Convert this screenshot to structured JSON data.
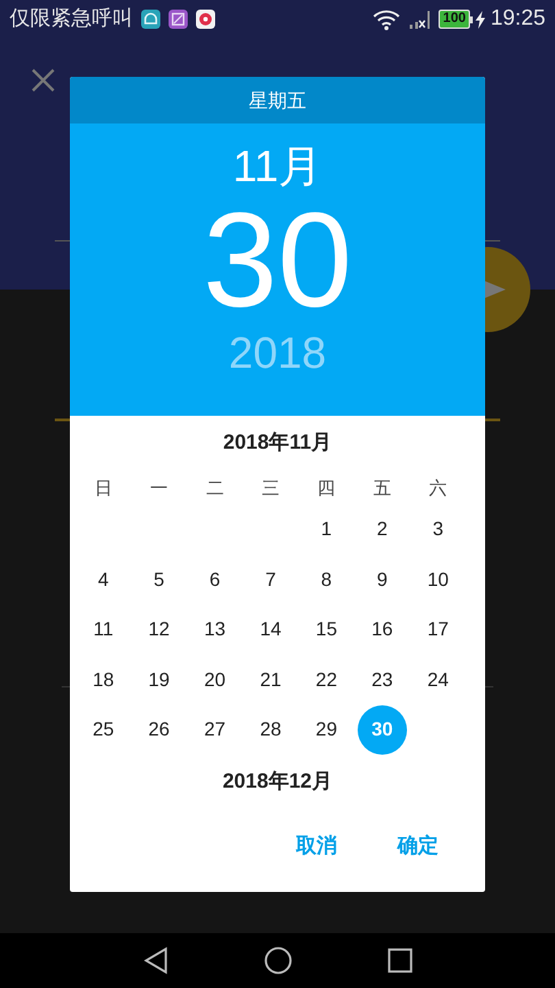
{
  "status_bar": {
    "carrier_text": "仅限紧急呼叫",
    "battery": "100",
    "time": "19:25"
  },
  "date_dialog": {
    "weekday": "星期五",
    "month": "11月",
    "day": "30",
    "year": "2018",
    "calendar": {
      "month_title": "2018年11月",
      "weekdays": [
        "日",
        "一",
        "二",
        "三",
        "四",
        "五",
        "六"
      ],
      "weeks": [
        [
          {
            "label": "1",
            "selected": false
          },
          {
            "label": "2",
            "selected": false
          },
          {
            "label": "3",
            "selected": false
          }
        ],
        [
          {
            "label": "4",
            "selected": false
          },
          {
            "label": "5",
            "selected": false
          },
          {
            "label": "6",
            "selected": false
          },
          {
            "label": "7",
            "selected": false
          },
          {
            "label": "8",
            "selected": false
          },
          {
            "label": "9",
            "selected": false
          },
          {
            "label": "10",
            "selected": false
          }
        ],
        [
          {
            "label": "11",
            "selected": false
          },
          {
            "label": "12",
            "selected": false
          },
          {
            "label": "13",
            "selected": false
          },
          {
            "label": "14",
            "selected": false
          },
          {
            "label": "15",
            "selected": false
          },
          {
            "label": "16",
            "selected": false
          },
          {
            "label": "17",
            "selected": false
          }
        ],
        [
          {
            "label": "18",
            "selected": false
          },
          {
            "label": "19",
            "selected": false
          },
          {
            "label": "20",
            "selected": false
          },
          {
            "label": "21",
            "selected": false
          },
          {
            "label": "22",
            "selected": false
          },
          {
            "label": "23",
            "selected": false
          },
          {
            "label": "24",
            "selected": false
          }
        ],
        [
          {
            "label": "25",
            "selected": false
          },
          {
            "label": "26",
            "selected": false
          },
          {
            "label": "27",
            "selected": false
          },
          {
            "label": "28",
            "selected": false
          },
          {
            "label": "29",
            "selected": false
          },
          {
            "label": "30",
            "selected": true
          }
        ]
      ]
    },
    "next_month_title": "2018年12月",
    "buttons": [
      "取消",
      "确定"
    ]
  }
}
